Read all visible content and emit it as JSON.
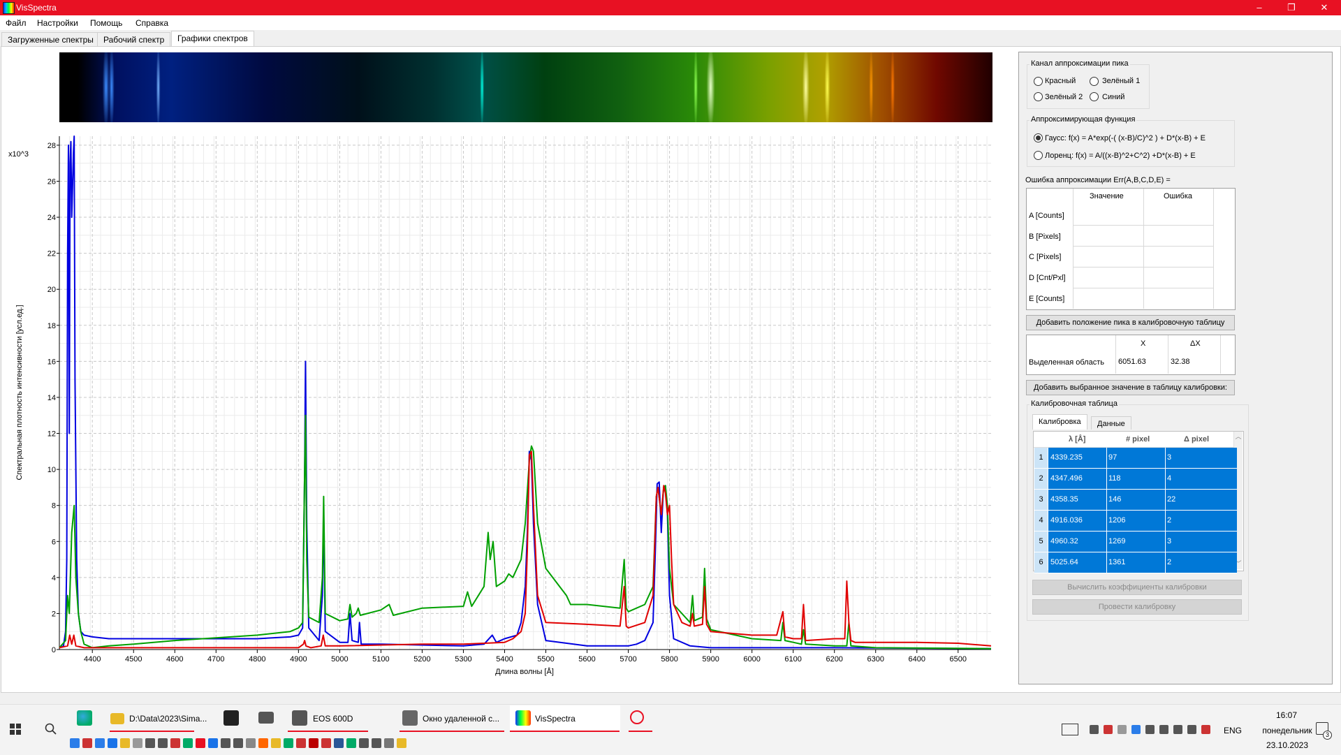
{
  "window": {
    "title": "VisSpectra",
    "controls": [
      "–",
      "❐",
      "✕"
    ]
  },
  "menu": [
    "Файл",
    "Настройки",
    "Помощь",
    "Справка"
  ],
  "tabs": [
    "Загруженные спектры",
    "Рабочий спектр",
    "Графики спектров"
  ],
  "active_tab": "Графики спектров",
  "chart": {
    "multiplier": "x10^3",
    "ylabel": "Спектральная плотность интенсивности [усл.ед.]",
    "xlabel": "Длина волны  [Å]"
  },
  "chart_data": {
    "type": "line",
    "xlim": [
      4320,
      6580
    ],
    "ylim": [
      0,
      28.5
    ],
    "x_ticks": [
      4400,
      4500,
      4600,
      4700,
      4800,
      4900,
      5000,
      5100,
      5200,
      5300,
      5400,
      5500,
      5600,
      5700,
      5800,
      5900,
      6000,
      6100,
      6200,
      6300,
      6400,
      6500
    ],
    "y_ticks": [
      0,
      2,
      4,
      6,
      8,
      10,
      12,
      14,
      16,
      18,
      20,
      22,
      24,
      26,
      28
    ],
    "grid": true,
    "series": [
      {
        "color": "#0000e0",
        "x": [
          4320,
          4330,
          4335,
          4338,
          4340,
          4342,
          4344,
          4346,
          4348,
          4350,
          4354,
          4356,
          4358,
          4362,
          4366,
          4372,
          4380,
          4400,
          4440,
          4500,
          4600,
          4800,
          4880,
          4900,
          4910,
          4915,
          4917,
          4920,
          4925,
          4950,
          4958,
          4961,
          4965,
          5000,
          5020,
          5025,
          5030,
          5045,
          5048,
          5052,
          5100,
          5300,
          5350,
          5370,
          5380,
          5400,
          5430,
          5440,
          5450,
          5455,
          5460,
          5465,
          5470,
          5480,
          5500,
          5600,
          5650,
          5700,
          5720,
          5740,
          5760,
          5765,
          5770,
          5775,
          5780,
          5785,
          5790,
          5795,
          5800,
          5810,
          5850,
          5900,
          6000,
          6200,
          6580
        ],
        "y": [
          0.1,
          0.2,
          1.0,
          5.0,
          22.0,
          28.0,
          12.0,
          27.0,
          28.2,
          24.0,
          27.5,
          28.5,
          15.0,
          5.0,
          2.0,
          1.0,
          0.8,
          0.7,
          0.6,
          0.6,
          0.6,
          0.6,
          0.7,
          0.8,
          1.2,
          10.0,
          16.0,
          7.0,
          1.2,
          0.5,
          3.0,
          7.5,
          1.0,
          0.4,
          0.4,
          2.0,
          0.5,
          0.4,
          1.5,
          0.3,
          0.3,
          0.2,
          0.3,
          0.8,
          0.4,
          0.6,
          0.8,
          1.5,
          3.5,
          6.5,
          11.0,
          10.5,
          7.0,
          2.5,
          0.5,
          0.2,
          0.2,
          0.2,
          0.3,
          0.5,
          1.5,
          5.0,
          9.2,
          9.3,
          6.5,
          8.8,
          9.1,
          7.5,
          3.0,
          0.6,
          0.2,
          0.1,
          0.1,
          0.1,
          0.05
        ]
      },
      {
        "color": "#00a000",
        "x": [
          4320,
          4335,
          4340,
          4344,
          4350,
          4356,
          4360,
          4366,
          4372,
          4380,
          4400,
          4440,
          4500,
          4600,
          4800,
          4880,
          4900,
          4910,
          4915,
          4917,
          4920,
          4925,
          4950,
          4958,
          4961,
          4965,
          5000,
          5020,
          5025,
          5030,
          5040,
          5045,
          5050,
          5100,
          5120,
          5130,
          5200,
          5300,
          5310,
          5320,
          5350,
          5360,
          5365,
          5372,
          5380,
          5400,
          5410,
          5420,
          5440,
          5450,
          5460,
          5465,
          5470,
          5480,
          5500,
          5550,
          5560,
          5600,
          5680,
          5690,
          5695,
          5700,
          5740,
          5760,
          5768,
          5772,
          5780,
          5786,
          5790,
          5795,
          5800,
          5810,
          5850,
          5856,
          5860,
          5880,
          5885,
          5890,
          5900,
          6000,
          6070,
          6075,
          6080,
          6100,
          6120,
          6125,
          6130,
          6200,
          6230,
          6235,
          6240,
          6300,
          6580
        ],
        "y": [
          0.1,
          0.5,
          3.0,
          2.0,
          6.5,
          8.0,
          4.0,
          2.0,
          1.0,
          0.3,
          0.1,
          0.2,
          0.3,
          0.5,
          0.8,
          1.0,
          1.2,
          1.5,
          10.0,
          13.0,
          5.0,
          1.8,
          1.5,
          4.0,
          8.5,
          2.0,
          1.6,
          1.7,
          2.5,
          1.8,
          2.0,
          2.3,
          1.9,
          2.2,
          2.5,
          1.9,
          2.3,
          2.4,
          3.2,
          2.4,
          3.5,
          6.5,
          5.0,
          6.0,
          3.5,
          3.8,
          4.2,
          4.0,
          5.0,
          7.0,
          10.5,
          11.3,
          11.0,
          7.0,
          4.5,
          3.0,
          2.5,
          2.5,
          2.3,
          5.0,
          2.3,
          2.1,
          2.5,
          3.5,
          8.5,
          9.0,
          7.5,
          9.0,
          9.1,
          8.0,
          4.5,
          2.5,
          1.5,
          3.0,
          1.6,
          1.8,
          4.5,
          1.7,
          1.1,
          0.6,
          0.5,
          1.5,
          0.5,
          0.4,
          0.3,
          1.1,
          0.3,
          0.2,
          0.2,
          1.5,
          0.2,
          0.1,
          0.05
        ]
      },
      {
        "color": "#e00000",
        "x": [
          4320,
          4340,
          4345,
          4350,
          4355,
          4360,
          4380,
          4500,
          4800,
          4900,
          4912,
          4915,
          4918,
          4930,
          4955,
          4960,
          4965,
          5000,
          5200,
          5300,
          5400,
          5420,
          5440,
          5450,
          5455,
          5460,
          5465,
          5470,
          5480,
          5500,
          5600,
          5680,
          5690,
          5695,
          5700,
          5740,
          5760,
          5768,
          5772,
          5780,
          5786,
          5790,
          5795,
          5800,
          5805,
          5810,
          5830,
          5850,
          5856,
          5860,
          5880,
          5885,
          5890,
          5900,
          6000,
          6060,
          6075,
          6080,
          6100,
          6120,
          6125,
          6130,
          6200,
          6225,
          6230,
          6235,
          6240,
          6250,
          6300,
          6400,
          6500,
          6580
        ],
        "y": [
          0.1,
          0.2,
          0.8,
          0.3,
          0.8,
          0.2,
          0.1,
          0.1,
          0.1,
          0.1,
          0.3,
          0.5,
          0.2,
          0.1,
          0.2,
          0.8,
          0.2,
          0.2,
          0.3,
          0.3,
          0.4,
          0.6,
          1.0,
          2.0,
          5.5,
          10.8,
          11.0,
          8.0,
          3.0,
          1.5,
          1.4,
          1.3,
          3.5,
          1.3,
          1.2,
          1.5,
          3.0,
          8.5,
          9.0,
          7.5,
          9.1,
          8.7,
          7.5,
          8.0,
          5.0,
          2.5,
          1.5,
          1.3,
          2.0,
          1.3,
          1.4,
          3.5,
          1.4,
          1.0,
          0.8,
          0.8,
          2.1,
          0.7,
          0.6,
          0.6,
          2.5,
          0.5,
          0.6,
          0.6,
          3.8,
          1.5,
          0.5,
          0.4,
          0.4,
          0.4,
          0.35,
          0.2
        ]
      }
    ]
  },
  "right_panel": {
    "channel": {
      "title": "Канал аппроксимации пика",
      "options": [
        "Красный",
        "Зелёный 1",
        "Зелёный 2",
        "Синий"
      ]
    },
    "func": {
      "title": "Аппроксимирующая функция",
      "gauss": "Гаусс: f(x) =  A*exp(-( (x-B)/C)^2 ) + D*(x-B) + E",
      "lorentz": "Лоренц: f(x) = A/((x-B)^2+C^2) +D*(x-B) + E"
    },
    "err_label": "Ошибка аппроксимации Err(A,B,C,D,E) =",
    "fit_table": {
      "headers": [
        "Значение",
        "Ошибка"
      ],
      "rows": [
        "A [Counts]",
        "B [Pixels]",
        "C [Pixels]",
        "D [Cnt/Pxl]",
        "E [Counts]"
      ]
    },
    "add_peak_btn": "Добавить положение пика в калибровочную таблицу",
    "selection": {
      "x_header": "X",
      "dx_header": "ΔX",
      "label": "Выделенная область",
      "x": "6051.63",
      "dx": "32.38"
    },
    "add_value_btn": "Добавить выбранное значение в таблицу калибровки:",
    "calib": {
      "title": "Калибровочная таблица",
      "tabs": [
        "Калибровка",
        "Данные"
      ],
      "headers": [
        "λ [Å]",
        "# pixel",
        "Δ pixel"
      ],
      "rows": [
        {
          "n": "1",
          "lambda": "4339.235",
          "pixel": "97",
          "dpixel": "3"
        },
        {
          "n": "2",
          "lambda": "4347.496",
          "pixel": "118",
          "dpixel": "4"
        },
        {
          "n": "3",
          "lambda": "4358.35",
          "pixel": "146",
          "dpixel": "22"
        },
        {
          "n": "4",
          "lambda": "4916.036",
          "pixel": "1206",
          "dpixel": "2"
        },
        {
          "n": "5",
          "lambda": "4960.32",
          "pixel": "1269",
          "dpixel": "3"
        },
        {
          "n": "6",
          "lambda": "5025.64",
          "pixel": "1361",
          "dpixel": "2"
        }
      ]
    },
    "calc_btn": "Вычислить коэффициенты калибровки",
    "run_btn": "Провести калибровку"
  },
  "taskbar": {
    "apps": [
      "D:\\Data\\2023\\Sima...",
      "EOS 600D",
      "Окно удаленной с...",
      "VisSpectra"
    ],
    "lang": "ENG",
    "time": "16:07",
    "day": "понедельник",
    "date": "23.10.2023",
    "notif_count": "3"
  }
}
